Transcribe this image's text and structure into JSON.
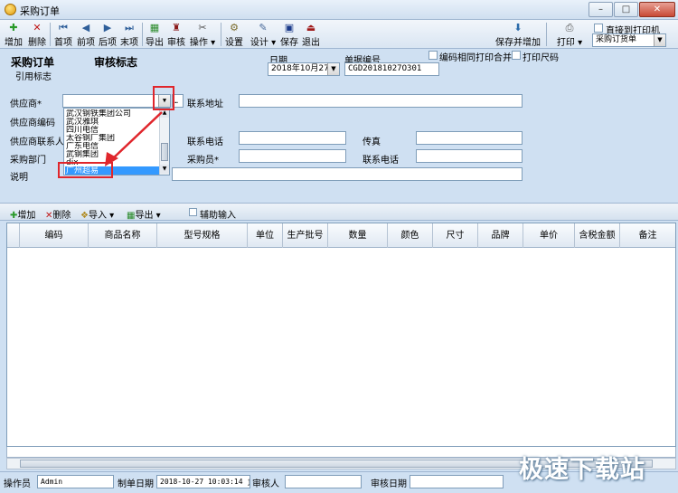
{
  "window": {
    "title": "采购订单"
  },
  "toolbar": {
    "buttons": {
      "add": "增加",
      "delete": "删除",
      "first": "首项",
      "prev": "前项",
      "next": "后项",
      "last": "末项",
      "export": "导出",
      "audit": "审核",
      "operate": "操作",
      "settings": "设置",
      "design": "设计",
      "save": "保存",
      "exit": "退出",
      "save_add": "保存并增加",
      "print": "打印"
    },
    "direct_print_label": "直接到打印机",
    "print_template": "采购订货单"
  },
  "form": {
    "heading": "采购订单",
    "audit_flag_label": "审核标志",
    "ref_flag_label": "引用标志",
    "date_label": "日期",
    "date_value": "2018年10月27日",
    "doc_no_label": "单据编号",
    "doc_no_value": "CGD20181027O301",
    "merge_print_label": "编码相同打印合并",
    "print_size_label": "打印尺码",
    "supplier_label": "供应商*",
    "contact_addr_label": "联系地址",
    "supplier_code_label": "供应商编码",
    "supplier_contact_label": "供应商联系人",
    "contact_phone_label": "联系电话",
    "fax_label": "传真",
    "dept_label": "采购部门",
    "buyer_label": "采购员*",
    "contact_phone2_label": "联系电话",
    "note_label": "说明"
  },
  "supplier_options": [
    "武汉钢铁集团公司",
    "武汉雅琪",
    "四川电信",
    "太谷钢厂集团",
    "广东电信",
    "武钢集团",
    "dix",
    "广州超易"
  ],
  "detail_toolbar": {
    "add": "增加",
    "delete": "删除",
    "import": "导入",
    "export": "导出",
    "assist_input": "辅助输入"
  },
  "grid": {
    "columns": [
      "编码",
      "商品名称",
      "型号规格",
      "单位",
      "生产批号",
      "数量",
      "颜色",
      "尺寸",
      "品牌",
      "单价",
      "含税金额",
      "备注"
    ]
  },
  "status": {
    "operator_label": "操作员",
    "operator_value": "Admin",
    "make_date_label": "制单日期",
    "make_date_value": "2018-10-27 10:03:14 ji",
    "auditor_label": "审核人",
    "audit_date_label": "审核日期"
  },
  "watermark": "极速下载站",
  "colors": {
    "accent": "#3399ff",
    "highlight": "#e0262c",
    "background": "#cfe0f2"
  }
}
